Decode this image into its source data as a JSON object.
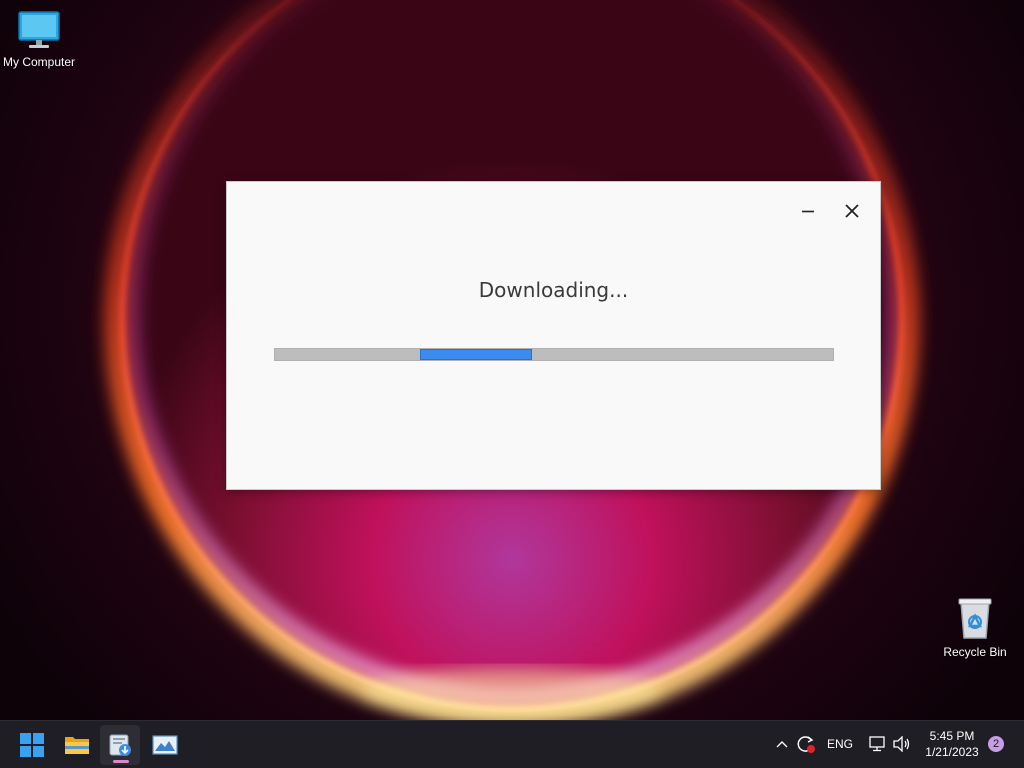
{
  "desktop": {
    "icons": [
      {
        "label": "My Computer",
        "icon": "monitor-icon"
      },
      {
        "label": "Recycle Bin",
        "icon": "recycle-bin-icon"
      }
    ]
  },
  "dialog": {
    "title": "Downloading...",
    "progress": {
      "segment_start": 0.26,
      "segment_end": 0.46,
      "fill_color": "#3c8cf0",
      "track_color": "#bdbdbd"
    },
    "minimize_icon": "minimize-icon",
    "close_icon": "close-icon"
  },
  "taskbar": {
    "apps": [
      {
        "name": "start",
        "icon": "windows-logo-icon"
      },
      {
        "name": "file-explorer",
        "icon": "folder-icon"
      },
      {
        "name": "installer",
        "icon": "installer-icon",
        "active": true
      },
      {
        "name": "image-viewer",
        "icon": "image-viewer-icon"
      }
    ],
    "tray": {
      "language": "ENG",
      "time": "5:45 PM",
      "date": "1/21/2023",
      "notification_count": "2",
      "icons": [
        "chevron-up-icon",
        "update-icon",
        "network-icon",
        "volume-icon"
      ]
    },
    "accent_color": "#d98ac6"
  }
}
